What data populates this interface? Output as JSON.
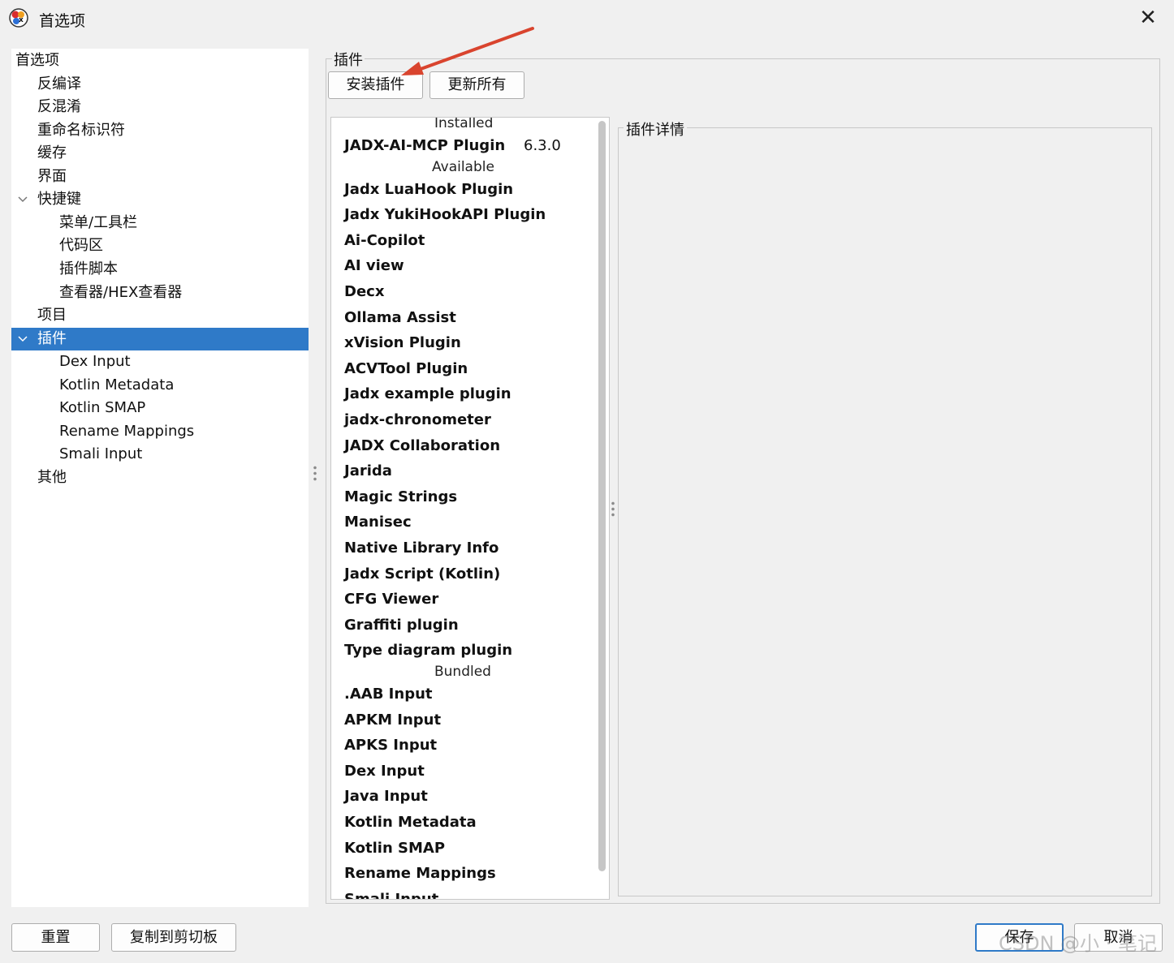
{
  "window": {
    "title": "首选项",
    "close_glyph": "✕",
    "app_icon": "jadx-logo-icon"
  },
  "tree": {
    "items": [
      {
        "label": "首选项",
        "level": 0
      },
      {
        "label": "反编译",
        "level": 1
      },
      {
        "label": "反混淆",
        "level": 1
      },
      {
        "label": "重命名标识符",
        "level": 1
      },
      {
        "label": "缓存",
        "level": 1
      },
      {
        "label": "界面",
        "level": 1
      },
      {
        "label": "快捷键",
        "level": 1,
        "expanded": true
      },
      {
        "label": "菜单/工具栏",
        "level": 2
      },
      {
        "label": "代码区",
        "level": 2
      },
      {
        "label": "插件脚本",
        "level": 2
      },
      {
        "label": "查看器/HEX查看器",
        "level": 2
      },
      {
        "label": "项目",
        "level": 1
      },
      {
        "label": "插件",
        "level": 1,
        "expanded": true,
        "selected": true
      },
      {
        "label": "Dex Input",
        "level": 2
      },
      {
        "label": "Kotlin Metadata",
        "level": 2
      },
      {
        "label": "Kotlin SMAP",
        "level": 2
      },
      {
        "label": "Rename Mappings",
        "level": 2
      },
      {
        "label": "Smali Input",
        "level": 2
      },
      {
        "label": "其他",
        "level": 1
      }
    ]
  },
  "plugins": {
    "group_title": "插件",
    "install_button": "安装插件",
    "update_all_button": "更新所有",
    "details_title": "插件详情",
    "list": [
      {
        "type": "header",
        "text": "Installed"
      },
      {
        "type": "item",
        "text": "JADX-AI-MCP Plugin",
        "version": "6.3.0"
      },
      {
        "type": "header",
        "text": "Available"
      },
      {
        "type": "item",
        "text": "Jadx LuaHook Plugin"
      },
      {
        "type": "item",
        "text": "Jadx YukiHookAPI Plugin"
      },
      {
        "type": "item",
        "text": "Ai-Copilot"
      },
      {
        "type": "item",
        "text": "AI view"
      },
      {
        "type": "item",
        "text": "Decx"
      },
      {
        "type": "item",
        "text": "Ollama Assist"
      },
      {
        "type": "item",
        "text": "xVision Plugin"
      },
      {
        "type": "item",
        "text": "ACVTool Plugin"
      },
      {
        "type": "item",
        "text": "Jadx example plugin"
      },
      {
        "type": "item",
        "text": "jadx-chronometer"
      },
      {
        "type": "item",
        "text": "JADX Collaboration"
      },
      {
        "type": "item",
        "text": "Jarida"
      },
      {
        "type": "item",
        "text": "Magic Strings"
      },
      {
        "type": "item",
        "text": "Manisec"
      },
      {
        "type": "item",
        "text": "Native Library Info"
      },
      {
        "type": "item",
        "text": "Jadx Script (Kotlin)"
      },
      {
        "type": "item",
        "text": "CFG Viewer"
      },
      {
        "type": "item",
        "text": "Graffiti plugin"
      },
      {
        "type": "item",
        "text": "Type diagram plugin"
      },
      {
        "type": "header",
        "text": "Bundled"
      },
      {
        "type": "item",
        "text": ".AAB Input"
      },
      {
        "type": "item",
        "text": "APKM Input"
      },
      {
        "type": "item",
        "text": "APKS Input"
      },
      {
        "type": "item",
        "text": "Dex Input"
      },
      {
        "type": "item",
        "text": "Java Input"
      },
      {
        "type": "item",
        "text": "Kotlin Metadata"
      },
      {
        "type": "item",
        "text": "Kotlin SMAP"
      },
      {
        "type": "item",
        "text": "Rename Mappings"
      },
      {
        "type": "item",
        "text": "Smali Input"
      }
    ]
  },
  "footer": {
    "reset_button": "重置",
    "copy_button": "复制到剪切板",
    "save_button": "保存",
    "cancel_button": "取消"
  },
  "watermark": "CSDN @小 · 笔记",
  "colors": {
    "selection": "#2f7ac8",
    "annotation_arrow": "#d9442e"
  }
}
